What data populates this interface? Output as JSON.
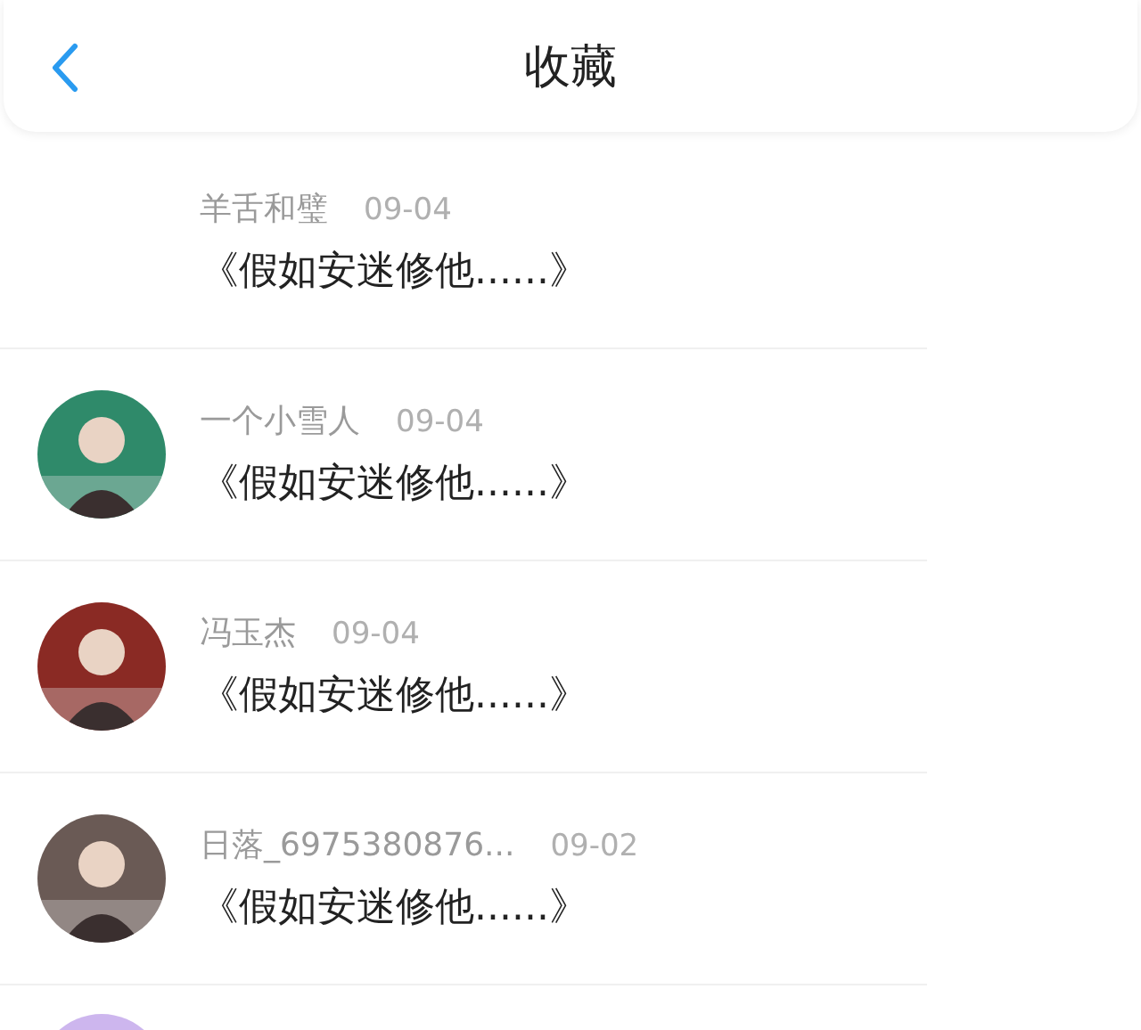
{
  "header": {
    "title": "收藏"
  },
  "items": [
    {
      "avatar": false,
      "name": "羊舌和璧",
      "date": "09-04",
      "title": "《假如安迷修他......》"
    },
    {
      "avatar": true,
      "name": "一个小雪人",
      "date": "09-04",
      "title": "《假如安迷修他......》"
    },
    {
      "avatar": true,
      "name": "冯玉杰",
      "date": "09-04",
      "title": "《假如安迷修他......》"
    },
    {
      "avatar": true,
      "name": "日落_6975380876...",
      "date": "09-02",
      "title": "《假如安迷修他......》"
    },
    {
      "avatar": true
    }
  ]
}
